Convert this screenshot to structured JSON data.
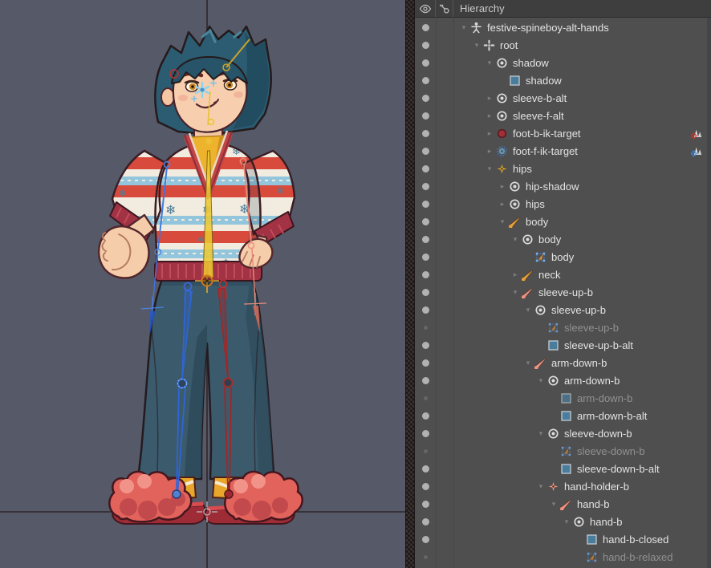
{
  "panel": {
    "title": "Hierarchy",
    "columns": {
      "visibility_icon": "eye-icon",
      "lock_icon": "key-icon"
    }
  },
  "viewport": {
    "skeleton_name": "festive-spineboy-alt-hands",
    "background": "#565a68",
    "axis_color": "#2f2628"
  },
  "icon_colors": {
    "bone_orange": "#e8a23a",
    "bone_salmon": "#ef9484",
    "cross_yellow": "#e8b02c",
    "cross_salmon": "#ef9484",
    "bone_red_fill": "#a03038",
    "bone_blue_fill": "#6a93ae",
    "region_fill": "#4a7d9c",
    "mesh_blue": "#4a8ad8",
    "mesh_orange": "#e09030",
    "slot_gray": "#dcdcdc",
    "ik_red": "#d03028",
    "ik_blue": "#3a86e0"
  },
  "hierarchy": {
    "rows": [
      {
        "label": "festive-spineboy-alt-hands",
        "icon": "skeleton",
        "level": 0,
        "arrow": "open",
        "dot": true,
        "dimmed": false,
        "badge": null
      },
      {
        "label": "root",
        "icon": "bone-root",
        "level": 1,
        "arrow": "open",
        "dot": true,
        "dimmed": false,
        "badge": null
      },
      {
        "label": "shadow",
        "icon": "slot",
        "level": 2,
        "arrow": "open",
        "dot": true,
        "dimmed": false,
        "badge": null
      },
      {
        "label": "shadow",
        "icon": "region",
        "level": 3,
        "arrow": null,
        "dot": true,
        "dimmed": false,
        "badge": null
      },
      {
        "label": "sleeve-b-alt",
        "icon": "slot",
        "level": 2,
        "arrow": "closed",
        "dot": true,
        "dimmed": false,
        "badge": null
      },
      {
        "label": "sleeve-f-alt",
        "icon": "slot",
        "level": 2,
        "arrow": "closed",
        "dot": true,
        "dimmed": false,
        "badge": null
      },
      {
        "label": "foot-b-ik-target",
        "icon": "bone-red",
        "level": 2,
        "arrow": "closed",
        "dot": true,
        "dimmed": false,
        "badge": "ik-red"
      },
      {
        "label": "foot-f-ik-target",
        "icon": "bone-blue",
        "level": 2,
        "arrow": "closed",
        "dot": true,
        "dimmed": false,
        "badge": "ik-blue"
      },
      {
        "label": "hips",
        "icon": "cross-yellow",
        "level": 2,
        "arrow": "open",
        "dot": true,
        "dimmed": false,
        "badge": null
      },
      {
        "label": "hip-shadow",
        "icon": "slot",
        "level": 3,
        "arrow": "closed",
        "dot": true,
        "dimmed": false,
        "badge": null
      },
      {
        "label": "hips",
        "icon": "slot",
        "level": 3,
        "arrow": "closed",
        "dot": true,
        "dimmed": false,
        "badge": null
      },
      {
        "label": "body",
        "icon": "bone-orange",
        "level": 3,
        "arrow": "open",
        "dot": true,
        "dimmed": false,
        "badge": null
      },
      {
        "label": "body",
        "icon": "slot",
        "level": 4,
        "arrow": "open",
        "dot": true,
        "dimmed": false,
        "badge": null
      },
      {
        "label": "body",
        "icon": "mesh",
        "level": 5,
        "arrow": null,
        "dot": true,
        "dimmed": false,
        "badge": null
      },
      {
        "label": "neck",
        "icon": "bone-orange",
        "level": 4,
        "arrow": "closed",
        "dot": true,
        "dimmed": false,
        "badge": null
      },
      {
        "label": "sleeve-up-b",
        "icon": "bone-salmon",
        "level": 4,
        "arrow": "open",
        "dot": true,
        "dimmed": false,
        "badge": null
      },
      {
        "label": "sleeve-up-b",
        "icon": "slot",
        "level": 5,
        "arrow": "open",
        "dot": true,
        "dimmed": false,
        "badge": null
      },
      {
        "label": "sleeve-up-b",
        "icon": "mesh",
        "level": 6,
        "arrow": null,
        "dot": false,
        "dimmed": true,
        "badge": null
      },
      {
        "label": "sleeve-up-b-alt",
        "icon": "region",
        "level": 6,
        "arrow": null,
        "dot": true,
        "dimmed": false,
        "badge": null
      },
      {
        "label": "arm-down-b",
        "icon": "bone-salmon",
        "level": 5,
        "arrow": "open",
        "dot": true,
        "dimmed": false,
        "badge": null
      },
      {
        "label": "arm-down-b",
        "icon": "slot",
        "level": 6,
        "arrow": "open",
        "dot": true,
        "dimmed": false,
        "badge": null
      },
      {
        "label": "arm-down-b",
        "icon": "region",
        "level": 7,
        "arrow": null,
        "dot": false,
        "dimmed": true,
        "badge": null
      },
      {
        "label": "arm-down-b-alt",
        "icon": "region",
        "level": 7,
        "arrow": null,
        "dot": true,
        "dimmed": false,
        "badge": null
      },
      {
        "label": "sleeve-down-b",
        "icon": "slot",
        "level": 6,
        "arrow": "open",
        "dot": true,
        "dimmed": false,
        "badge": null
      },
      {
        "label": "sleeve-down-b",
        "icon": "mesh",
        "level": 7,
        "arrow": null,
        "dot": false,
        "dimmed": true,
        "badge": null
      },
      {
        "label": "sleeve-down-b-alt",
        "icon": "region",
        "level": 7,
        "arrow": null,
        "dot": true,
        "dimmed": false,
        "badge": null
      },
      {
        "label": "hand-holder-b",
        "icon": "cross-salmon",
        "level": 6,
        "arrow": "open",
        "dot": true,
        "dimmed": false,
        "badge": null
      },
      {
        "label": "hand-b",
        "icon": "bone-salmon",
        "level": 7,
        "arrow": "open",
        "dot": true,
        "dimmed": false,
        "badge": null
      },
      {
        "label": "hand-b",
        "icon": "slot",
        "level": 8,
        "arrow": "open",
        "dot": true,
        "dimmed": false,
        "badge": null
      },
      {
        "label": "hand-b-closed",
        "icon": "region",
        "level": 9,
        "arrow": null,
        "dot": true,
        "dimmed": false,
        "badge": null
      },
      {
        "label": "hand-b-relaxed",
        "icon": "mesh",
        "level": 9,
        "arrow": null,
        "dot": false,
        "dimmed": true,
        "badge": null
      }
    ]
  }
}
